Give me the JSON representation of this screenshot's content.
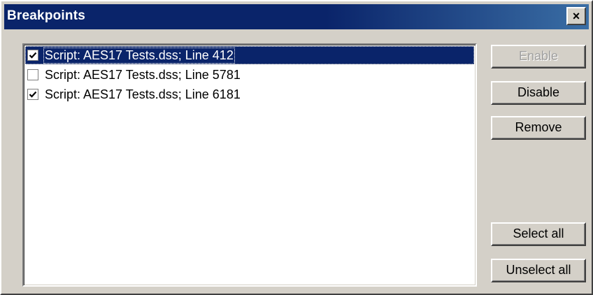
{
  "window": {
    "title": "Breakpoints",
    "close_label": "×"
  },
  "breakpoints": [
    {
      "label": "Script: AES17 Tests.dss; Line 412",
      "checked": true,
      "selected": true
    },
    {
      "label": "Script: AES17 Tests.dss; Line 5781",
      "checked": false,
      "selected": false
    },
    {
      "label": "Script: AES17 Tests.dss; Line 6181",
      "checked": true,
      "selected": false
    }
  ],
  "buttons": {
    "enable": {
      "label": "Enable",
      "enabled": false
    },
    "disable": {
      "label": "Disable",
      "enabled": true
    },
    "remove": {
      "label": "Remove",
      "enabled": true
    },
    "select_all": {
      "label": "Select all",
      "enabled": true
    },
    "unselect_all": {
      "label": "Unselect all",
      "enabled": true
    }
  },
  "colors": {
    "titlebar": "#0a246a",
    "face": "#d4d0c8",
    "selection": "#0a246a"
  }
}
